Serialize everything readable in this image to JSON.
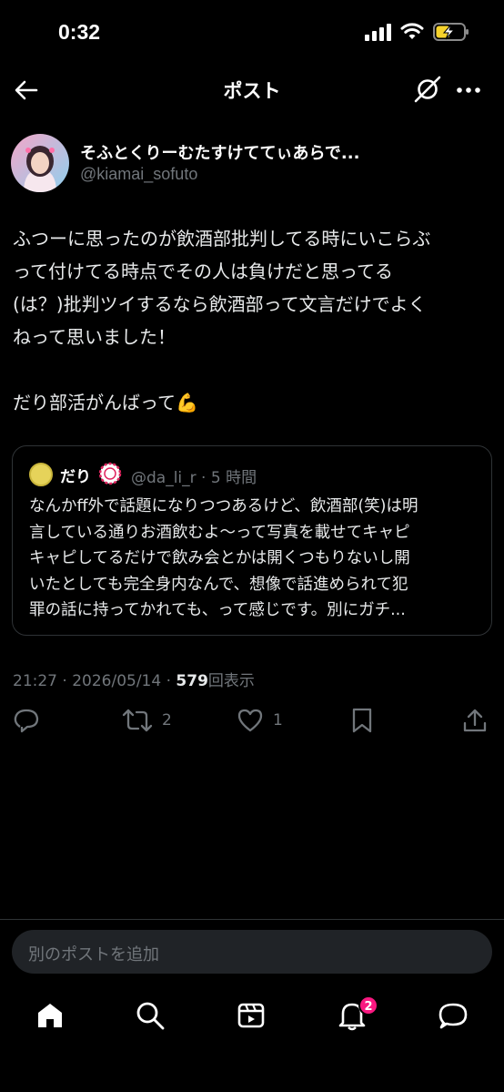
{
  "status_bar": {
    "time": "0:32"
  },
  "header": {
    "title": "ポスト"
  },
  "author": {
    "name": "そふとくりーむたすけててぃあらで...",
    "handle": "@kiamai_sofuto"
  },
  "post": {
    "lines": [
      "ふつーに思ったのが飲酒部批判してる時にいこらぶ",
      "って付けてる時点でその人は負けだと思ってる",
      "(は？)批判ツイするなら飲酒部って文言だけでよく",
      "ねって思いました！",
      "",
      "だり部活がんばって💪"
    ]
  },
  "quoted": {
    "name": "だり",
    "meta": "@da_li_r · 5 時間",
    "lines": [
      "なんかff外で話題になりつつあるけど、飲酒部(笑)は明",
      "言している通りお酒飲むよ〜って写真を載せてキャピ",
      "キャピしてるだけで飲み会とかは開くつもりないし開",
      "いたとしても完全身内なんで、想像で話進められて犯",
      "罪の話に持ってかれても、って感じです。別にガチ..."
    ]
  },
  "meta": {
    "timestamp": "21:27 · 2026/05/14 · ",
    "views": "579",
    "views_label": "回表示"
  },
  "actions": {
    "retweets": "2",
    "likes": "1"
  },
  "reply": {
    "placeholder": "別のポストを追加"
  },
  "tabbar": {
    "notifications_badge": "2"
  },
  "colors": {
    "accent": "#1d9bf0",
    "badge": "#f91880",
    "muted": "#71767b"
  }
}
